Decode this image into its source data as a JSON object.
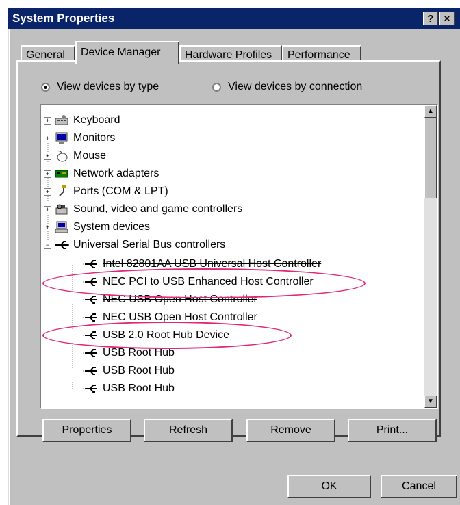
{
  "window": {
    "title": "System Properties",
    "help_label": "?",
    "close_label": "×"
  },
  "tabs": [
    {
      "label": "General"
    },
    {
      "label": "Device Manager"
    },
    {
      "label": "Hardware Profiles"
    },
    {
      "label": "Performance"
    }
  ],
  "view": {
    "by_type_label": "View devices by type",
    "by_connection_label": "View devices by connection",
    "selected": "by_type"
  },
  "tree": {
    "categories": [
      {
        "label": "Keyboard",
        "icon": "keyboard-icon",
        "expanded": false
      },
      {
        "label": "Monitors",
        "icon": "monitor-icon",
        "expanded": false
      },
      {
        "label": "Mouse",
        "icon": "mouse-icon",
        "expanded": false
      },
      {
        "label": "Network adapters",
        "icon": "network-adapter-icon",
        "expanded": false
      },
      {
        "label": "Ports (COM & LPT)",
        "icon": "port-icon",
        "expanded": false
      },
      {
        "label": "Sound, video and game controllers",
        "icon": "sound-icon",
        "expanded": false
      },
      {
        "label": "System devices",
        "icon": "computer-icon",
        "expanded": false
      },
      {
        "label": "Universal Serial Bus controllers",
        "icon": "usb-icon",
        "expanded": true
      }
    ],
    "usb_children": [
      {
        "label": "Intel 82801AA USB Universal Host Controller",
        "strikethrough": true,
        "highlighted": false
      },
      {
        "label": "NEC PCI to USB Enhanced Host Controller",
        "strikethrough": false,
        "highlighted": true
      },
      {
        "label": "NEC USB Open Host Controller",
        "strikethrough": true,
        "highlighted": false
      },
      {
        "label": "NEC USB Open Host Controller",
        "strikethrough": false,
        "highlighted": false
      },
      {
        "label": "USB 2.0 Root Hub Device",
        "strikethrough": false,
        "highlighted": true
      },
      {
        "label": "USB Root Hub",
        "strikethrough": false,
        "highlighted": false
      },
      {
        "label": "USB Root Hub",
        "strikethrough": false,
        "highlighted": false
      },
      {
        "label": "USB Root Hub",
        "strikethrough": false,
        "highlighted": false
      }
    ]
  },
  "actions": {
    "properties_label": "Properties",
    "refresh_label": "Refresh",
    "remove_label": "Remove",
    "print_label": "Print..."
  },
  "footer": {
    "ok_label": "OK",
    "cancel_label": "Cancel"
  },
  "colors": {
    "titlebar": "#0a246a",
    "face": "#c0c0c0",
    "highlight_ellipse": "#e0287a"
  }
}
